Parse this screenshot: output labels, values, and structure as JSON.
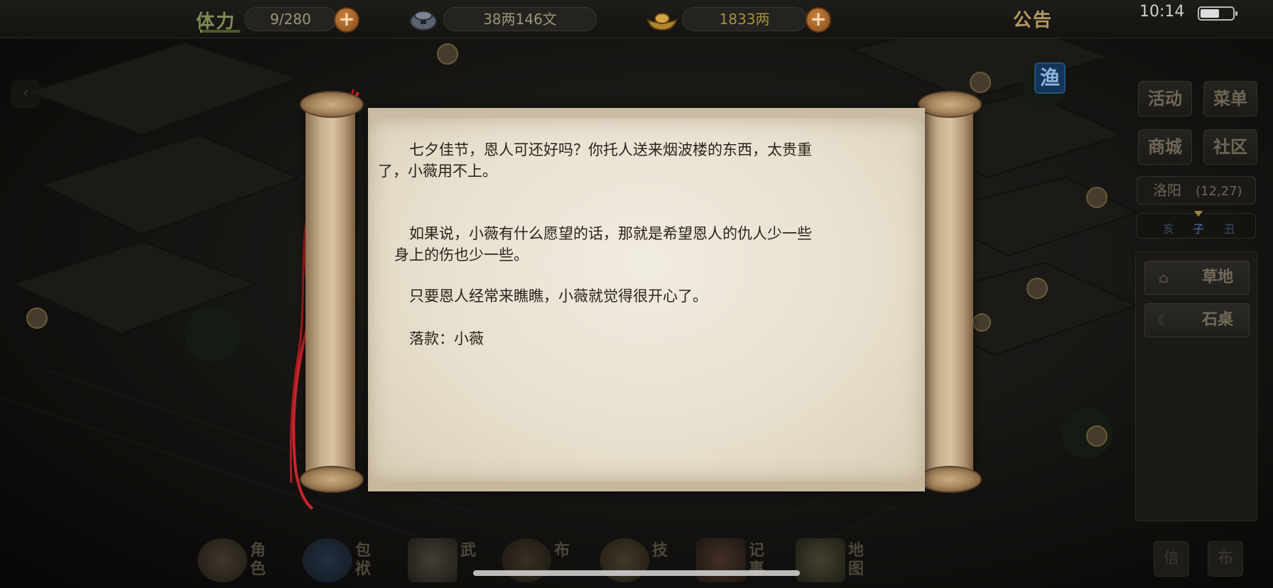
{
  "topbar": {
    "stamina_label": "体力",
    "stamina_value": "9/280",
    "stamina_fraction": 0.032,
    "copper_value": "38两146文",
    "gold_value": "1833两",
    "notice_label": "公告",
    "clock": "10:14",
    "battery_level": 0.6
  },
  "map": {
    "fish_badge": "渔"
  },
  "right_panel": {
    "buttons": [
      {
        "label": "活动"
      },
      {
        "label": "菜单"
      },
      {
        "label": "商城"
      },
      {
        "label": "社区"
      }
    ],
    "location_name": "洛阳",
    "location_coord": "(12,27)",
    "time_slots": [
      "亥",
      "子",
      "丑"
    ],
    "side_items": [
      {
        "label": "草地",
        "icon": "house-icon"
      },
      {
        "label": "石桌",
        "icon": "moon-icon"
      }
    ]
  },
  "bottom_nav": {
    "items": [
      {
        "label": "角色",
        "icon": "character-icon"
      },
      {
        "label": "包袱",
        "icon": "bag-icon"
      },
      {
        "label": "武",
        "icon": "martial-books-icon"
      },
      {
        "label": "布",
        "icon": "bagua-icon"
      },
      {
        "label": "技",
        "icon": "teapot-icon"
      },
      {
        "label": "记事",
        "icon": "journal-icon"
      },
      {
        "label": "地图",
        "icon": "map-icon"
      }
    ],
    "corner_buttons": [
      "信",
      "布"
    ]
  },
  "letter": {
    "paragraphs": [
      {
        "lines": [
          "　　七夕佳节，恩人可还好吗？你托人送来烟波楼的东西，太贵重",
          "了，小薇用不上。"
        ]
      },
      {
        "lines": [
          "　　如果说，小薇有什么愿望的话，那就是希望恩人的仇人少一些",
          "　身上的伤也少一些。"
        ]
      },
      {
        "lines": [
          "　　只要恩人经常来瞧瞧，小薇就觉得很开心了。"
        ]
      },
      {
        "lines": [
          "　　落款：小薇"
        ]
      }
    ]
  },
  "colors": {
    "paper": "#ece5d6",
    "ink": "#2b231b",
    "cord": "#c8262a",
    "accent_orange": "#b8702f"
  }
}
